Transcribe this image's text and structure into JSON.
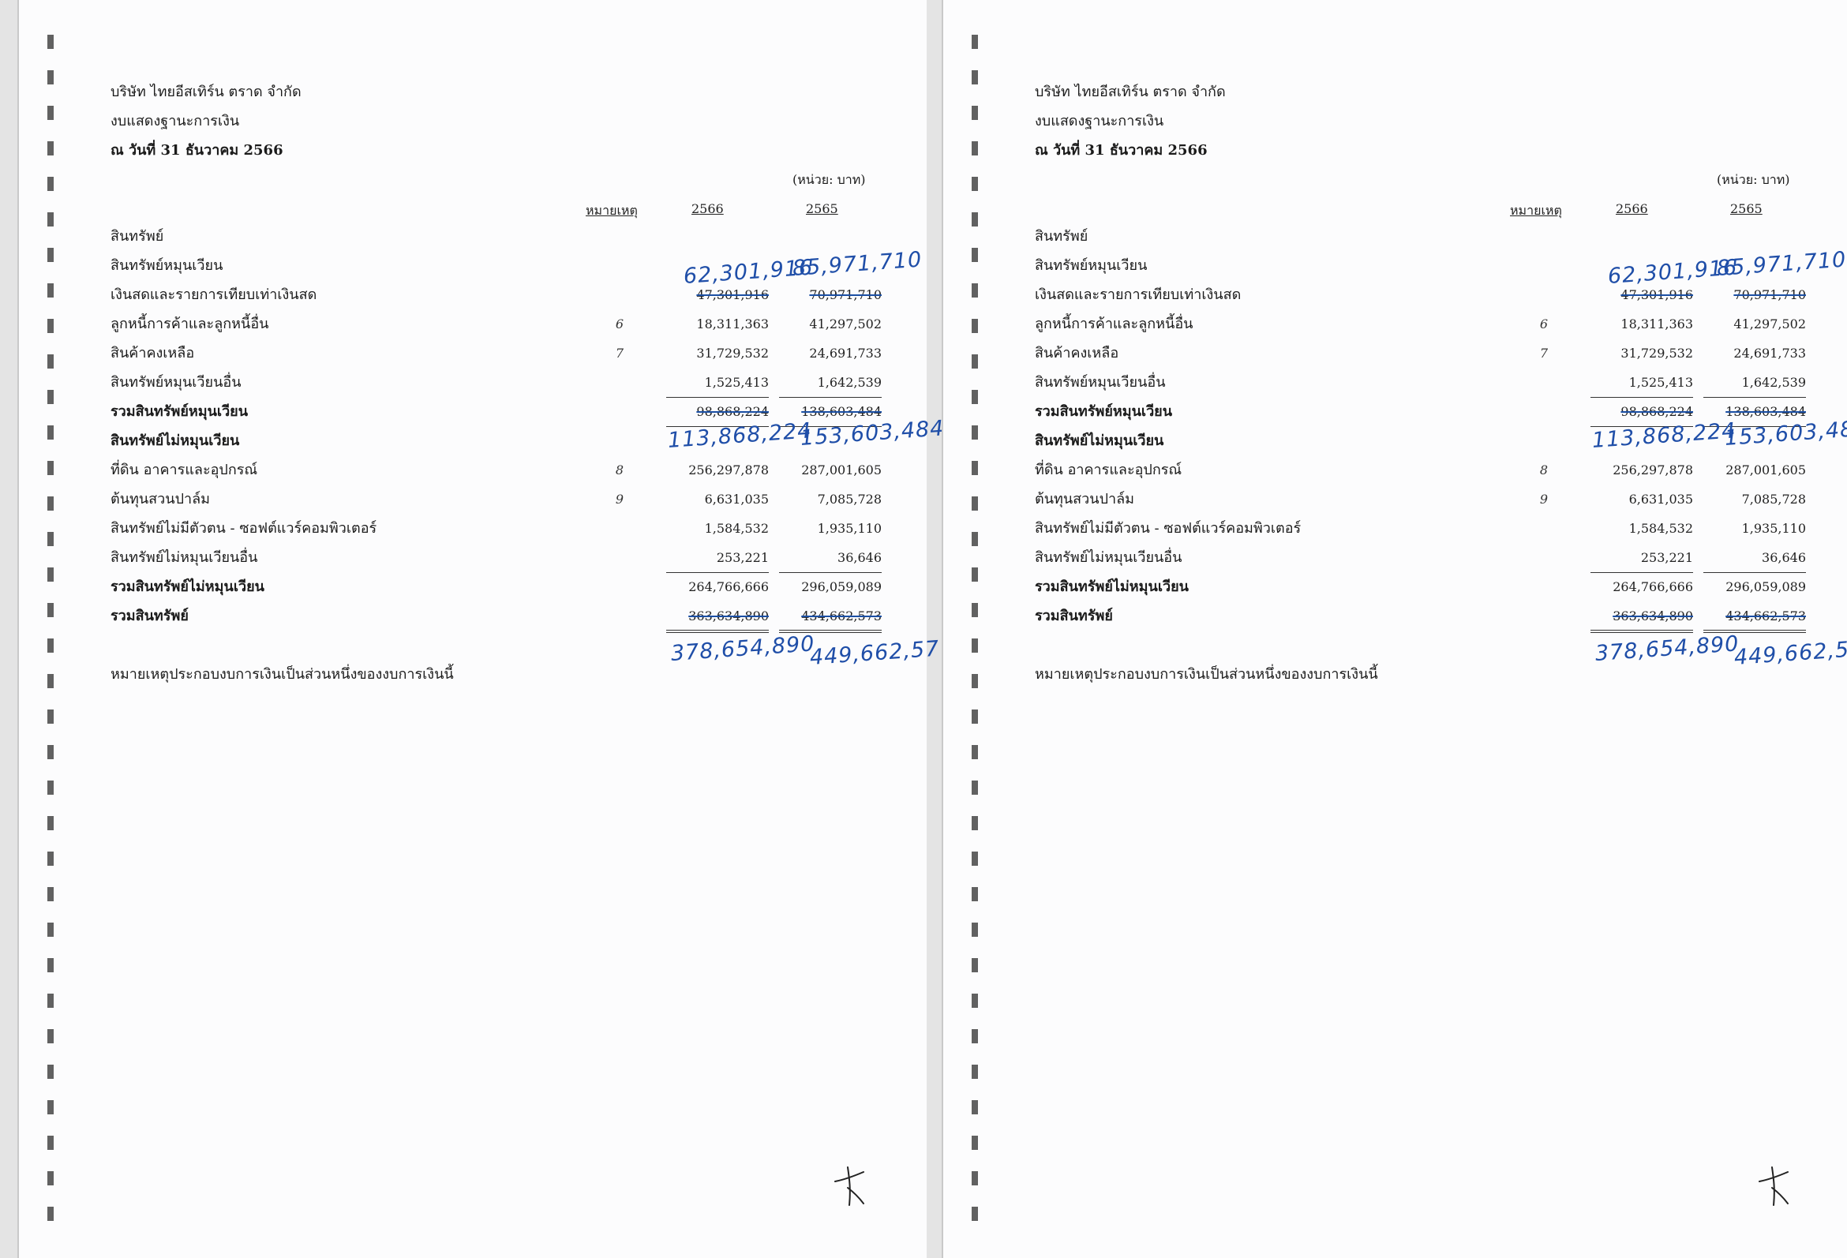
{
  "doc": {
    "company": "บริษัท ไทยอีสเทิร์น ตราด จำกัด",
    "statement": "งบแสดงฐานะการเงิน",
    "date": "ณ วันที่ 31 ธันวาคม 2566",
    "unit": "(หน่วย: บาท)",
    "col_note": "หมายเหตุ",
    "col_2566": "2566",
    "col_2565": "2565",
    "footer": "หมายเหตุประกอบงบการเงินเป็นส่วนหนึ่งของงบการเงินนี้"
  },
  "rows": [
    {
      "label": "สินทรัพย์",
      "note": "",
      "v2566": "",
      "v2565": ""
    },
    {
      "label": "สินทรัพย์หมุนเวียน",
      "note": "",
      "v2566": "",
      "v2565": ""
    },
    {
      "label": "เงินสดและรายการเทียบเท่าเงินสด",
      "note": "",
      "v2566": "47,301,916",
      "v2565": "70,971,710"
    },
    {
      "label": "ลูกหนี้การค้าและลูกหนี้อื่น",
      "note": "6",
      "v2566": "18,311,363",
      "v2565": "41,297,502"
    },
    {
      "label": "สินค้าคงเหลือ",
      "note": "7",
      "v2566": "31,729,532",
      "v2565": "24,691,733"
    },
    {
      "label": "สินทรัพย์หมุนเวียนอื่น",
      "note": "",
      "v2566": "1,525,413",
      "v2565": "1,642,539"
    },
    {
      "label": "รวมสินทรัพย์หมุนเวียน",
      "note": "",
      "v2566": "98,868,224",
      "v2565": "138,603,484"
    },
    {
      "label": "สินทรัพย์ไม่หมุนเวียน",
      "note": "",
      "v2566": "",
      "v2565": ""
    },
    {
      "label": "ที่ดิน อาคารและอุปกรณ์",
      "note": "8",
      "v2566": "256,297,878",
      "v2565": "287,001,605"
    },
    {
      "label": "ต้นทุนสวนปาล์ม",
      "note": "9",
      "v2566": "6,631,035",
      "v2565": "7,085,728"
    },
    {
      "label": "สินทรัพย์ไม่มีตัวตน - ซอฟต์แวร์คอมพิวเตอร์",
      "note": "",
      "v2566": "1,584,532",
      "v2565": "1,935,110"
    },
    {
      "label": "สินทรัพย์ไม่หมุนเวียนอื่น",
      "note": "",
      "v2566": "253,221",
      "v2565": "36,646"
    },
    {
      "label": "รวมสินทรัพย์ไม่หมุนเวียน",
      "note": "",
      "v2566": "264,766,666",
      "v2565": "296,059,089"
    },
    {
      "label": "รวมสินทรัพย์",
      "note": "",
      "v2566": "363,634,890",
      "v2565": "434,662,573"
    }
  ],
  "handwritten": {
    "cash_2566": "62,301,916",
    "cash_2565": "85,971,710",
    "cur_2566": "113,868,224",
    "cur_2565": "153,603,484",
    "tot_2566": "378,654,890",
    "tot_2565": "449,662,57"
  },
  "colors": {
    "ink": "#1f4ea8",
    "text": "#1b1b1b"
  }
}
